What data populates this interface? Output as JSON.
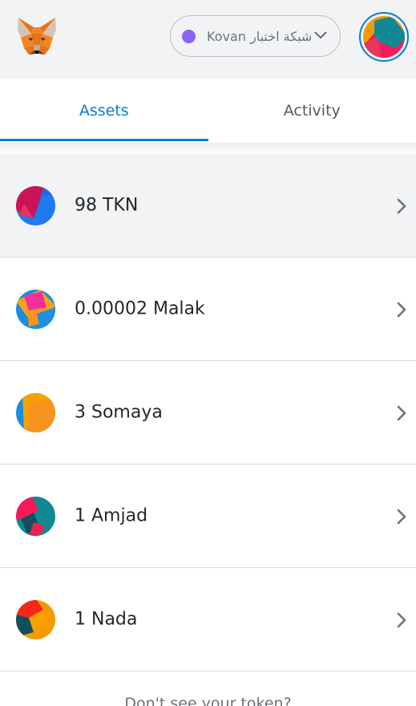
{
  "network": {
    "label": "شبكة اختبار Kovan",
    "dot_color": "#8a63f5"
  },
  "tabs": [
    {
      "label": "Assets",
      "active": true
    },
    {
      "label": "Activity",
      "active": false
    }
  ],
  "assets": [
    {
      "balance": "98 TKN",
      "icon": "tkn-token-icon"
    },
    {
      "balance": "0.00002 Malak",
      "icon": "malak-token-icon"
    },
    {
      "balance": "3 Somaya",
      "icon": "somaya-token-icon"
    },
    {
      "balance": "1 Amjad",
      "icon": "amjad-token-icon"
    },
    {
      "balance": "1 Nada",
      "icon": "nada-token-icon"
    }
  ],
  "footer": {
    "text": "Don't see your token?"
  },
  "colors": {
    "accent": "#037dd6",
    "header_bg": "#f2f3f4",
    "hover_row_bg": "#f2f3f4"
  }
}
